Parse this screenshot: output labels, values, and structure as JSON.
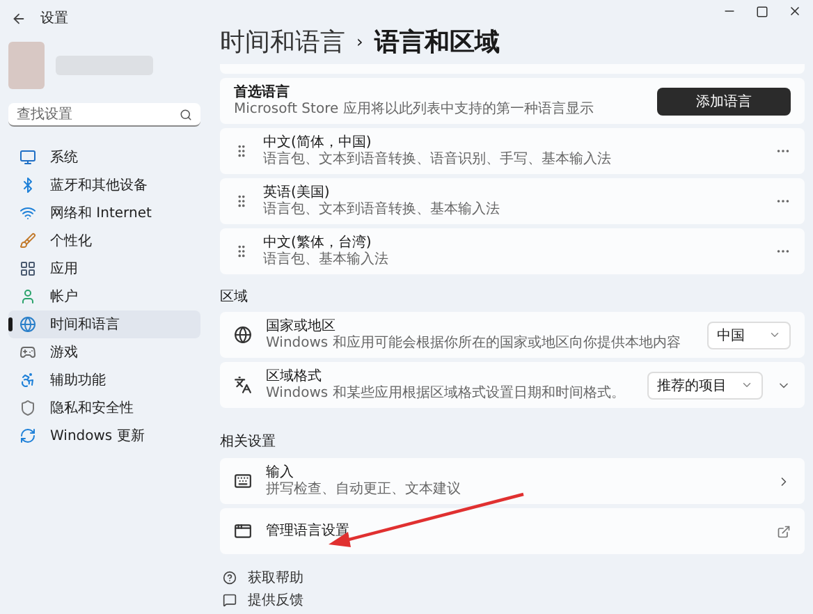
{
  "window": {
    "title": "设置"
  },
  "sidebar": {
    "search": {
      "placeholder": "查找设置"
    },
    "items": [
      {
        "label": "系统",
        "selected": false
      },
      {
        "label": "蓝牙和其他设备",
        "selected": false
      },
      {
        "label": "网络和 Internet",
        "selected": false
      },
      {
        "label": "个性化",
        "selected": false
      },
      {
        "label": "应用",
        "selected": false
      },
      {
        "label": "帐户",
        "selected": false
      },
      {
        "label": "时间和语言",
        "selected": true
      },
      {
        "label": "游戏",
        "selected": false
      },
      {
        "label": "辅助功能",
        "selected": false
      },
      {
        "label": "隐私和安全性",
        "selected": false
      },
      {
        "label": "Windows 更新",
        "selected": false
      }
    ]
  },
  "breadcrumb": {
    "parent": "时间和语言",
    "separator": "›",
    "current": "语言和区域"
  },
  "preferred_languages": {
    "title": "首选语言",
    "description": "Microsoft Store 应用将以此列表中支持的第一种语言显示",
    "button": "添加语言",
    "languages": [
      {
        "name": "中文(简体，中国)",
        "features": "语言包、文本到语音转换、语音识别、手写、基本输入法"
      },
      {
        "name": "英语(美国)",
        "features": "语言包、文本到语音转换、基本输入法"
      },
      {
        "name": "中文(繁体，台湾)",
        "features": "语言包、基本输入法"
      }
    ]
  },
  "region": {
    "heading": "区域",
    "settings": [
      {
        "title": "国家或地区",
        "description": "Windows 和应用可能会根据你所在的国家或地区向你提供本地内容",
        "value": "中国",
        "expandable": false
      },
      {
        "title": "区域格式",
        "description": "Windows 和某些应用根据区域格式设置日期和时间格式。",
        "value": "推荐的项目",
        "expandable": true
      }
    ]
  },
  "related": {
    "heading": "相关设置",
    "items": [
      {
        "kind": "link",
        "title": "输入",
        "description": "拼写检查、自动更正、文本建议"
      },
      {
        "kind": "external",
        "title": "管理语言设置"
      }
    ]
  },
  "footer": [
    {
      "label": "获取帮助"
    },
    {
      "label": "提供反馈"
    }
  ]
}
